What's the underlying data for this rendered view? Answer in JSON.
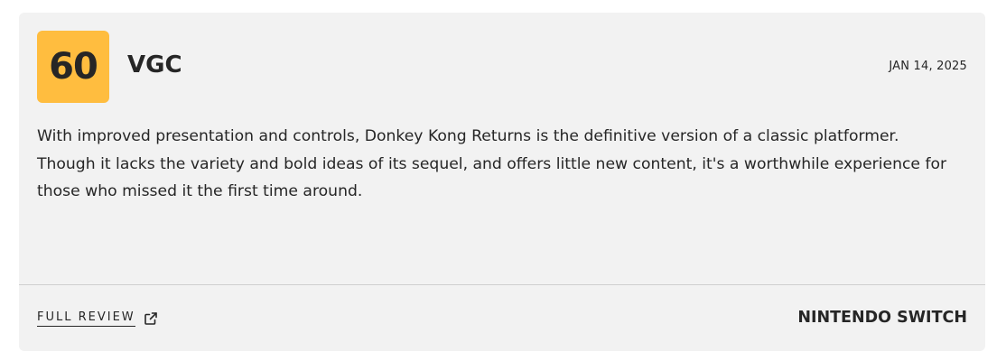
{
  "review": {
    "score": "60",
    "publication": "VGC",
    "date": "JAN 14, 2025",
    "quote": "With improved presentation and controls, Donkey Kong Returns is the definitive version of a classic platformer. Though it lacks the variety and bold ideas of its sequel, and offers little new content, it's a worthwhile experience for those who missed it the first time around.",
    "full_review_label": "FULL REVIEW",
    "full_review_icon": "external-link-icon",
    "platform": "NINTENDO SWITCH"
  },
  "colors": {
    "card_background": "#f2f2f2",
    "score_badge": "#ffbd3f",
    "text": "#262626",
    "divider": "#cfcfcf"
  }
}
